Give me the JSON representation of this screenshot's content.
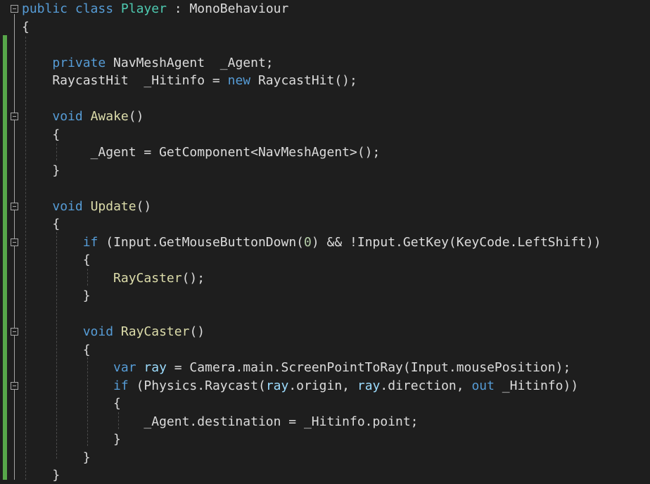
{
  "editor": {
    "language": "C#",
    "colors": {
      "background": "#1e1e1e",
      "keyword": "#569cd6",
      "type": "#4ec9b0",
      "method": "#dcdcaa",
      "number": "#b5cea8",
      "variable": "#9cdcfe",
      "plain": "#dcdcdc",
      "change_bar": "#57a64a"
    },
    "lines": [
      [
        {
          "t": "public",
          "c": "kw"
        },
        {
          "t": " ",
          "c": "pl"
        },
        {
          "t": "class",
          "c": "kw"
        },
        {
          "t": " ",
          "c": "pl"
        },
        {
          "t": "Player",
          "c": "ty"
        },
        {
          "t": " : MonoBehaviour",
          "c": "pl"
        }
      ],
      [
        {
          "t": "{",
          "c": "pl"
        }
      ],
      [],
      [
        {
          "t": "    ",
          "c": "pl"
        },
        {
          "t": "private",
          "c": "kw"
        },
        {
          "t": " NavMeshAgent  _Agent;",
          "c": "pl"
        }
      ],
      [
        {
          "t": "    RaycastHit  _Hitinfo = ",
          "c": "pl"
        },
        {
          "t": "new",
          "c": "kw"
        },
        {
          "t": " RaycastHit();",
          "c": "pl"
        }
      ],
      [],
      [
        {
          "t": "    ",
          "c": "pl"
        },
        {
          "t": "void",
          "c": "kw"
        },
        {
          "t": " ",
          "c": "pl"
        },
        {
          "t": "Awake",
          "c": "me"
        },
        {
          "t": "()",
          "c": "pl"
        }
      ],
      [
        {
          "t": "    {",
          "c": "pl"
        }
      ],
      [
        {
          "t": "         _Agent = GetComponent<NavMeshAgent>();",
          "c": "pl"
        }
      ],
      [
        {
          "t": "    }",
          "c": "pl"
        }
      ],
      [],
      [
        {
          "t": "    ",
          "c": "pl"
        },
        {
          "t": "void",
          "c": "kw"
        },
        {
          "t": " ",
          "c": "pl"
        },
        {
          "t": "Update",
          "c": "me"
        },
        {
          "t": "()",
          "c": "pl"
        }
      ],
      [
        {
          "t": "    {",
          "c": "pl"
        }
      ],
      [
        {
          "t": "        ",
          "c": "pl"
        },
        {
          "t": "if",
          "c": "kw"
        },
        {
          "t": " (Input.GetMouseButtonDown(",
          "c": "pl"
        },
        {
          "t": "0",
          "c": "nu"
        },
        {
          "t": ") && !Input.GetKey(KeyCode.LeftShift))",
          "c": "pl"
        }
      ],
      [
        {
          "t": "        {",
          "c": "pl"
        }
      ],
      [
        {
          "t": "            ",
          "c": "pl"
        },
        {
          "t": "RayCaster",
          "c": "me"
        },
        {
          "t": "();",
          "c": "pl"
        }
      ],
      [
        {
          "t": "        }",
          "c": "pl"
        }
      ],
      [],
      [
        {
          "t": "        ",
          "c": "pl"
        },
        {
          "t": "void",
          "c": "kw"
        },
        {
          "t": " ",
          "c": "pl"
        },
        {
          "t": "RayCaster",
          "c": "me"
        },
        {
          "t": "()",
          "c": "pl"
        }
      ],
      [
        {
          "t": "        {",
          "c": "pl"
        }
      ],
      [
        {
          "t": "            ",
          "c": "pl"
        },
        {
          "t": "var",
          "c": "kw"
        },
        {
          "t": " ",
          "c": "pl"
        },
        {
          "t": "ray",
          "c": "va"
        },
        {
          "t": " = Camera.main.ScreenPointToRay(Input.mousePosition);",
          "c": "pl"
        }
      ],
      [
        {
          "t": "            ",
          "c": "pl"
        },
        {
          "t": "if",
          "c": "kw"
        },
        {
          "t": " (Physics.Raycast(",
          "c": "pl"
        },
        {
          "t": "ray",
          "c": "va"
        },
        {
          "t": ".origin, ",
          "c": "pl"
        },
        {
          "t": "ray",
          "c": "va"
        },
        {
          "t": ".direction, ",
          "c": "pl"
        },
        {
          "t": "out",
          "c": "kw"
        },
        {
          "t": " _Hitinfo))",
          "c": "pl"
        }
      ],
      [
        {
          "t": "            {",
          "c": "pl"
        }
      ],
      [
        {
          "t": "                _Agent.destination = _Hitinfo.point;",
          "c": "pl"
        }
      ],
      [
        {
          "t": "            }",
          "c": "pl"
        }
      ],
      [
        {
          "t": "        }",
          "c": "pl"
        }
      ],
      [
        {
          "t": "    }",
          "c": "pl"
        }
      ]
    ],
    "fold_markers_at_lines": [
      0,
      6,
      11,
      13,
      18,
      21
    ]
  }
}
